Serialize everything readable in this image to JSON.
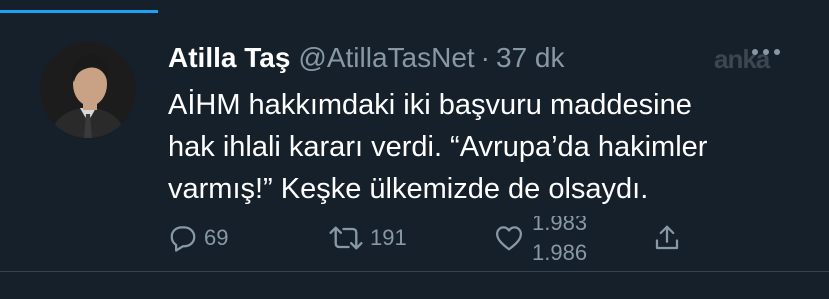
{
  "progress": {
    "fraction": 0.19,
    "color": "#1da1f2"
  },
  "tweet": {
    "author_name": "Atilla Taş",
    "handle": "@AtillaTasNet",
    "separator": "·",
    "time": "37 dk",
    "text": "AİHM hakkımdaki iki başvuru maddesine\nhak ihlali kararı verdi. “Avrupa’da hakimler\nvarmış!” Keşke ülkemizde de olsaydı."
  },
  "actions": {
    "reply_count": "69",
    "retweet_count": "191",
    "like_count_prev": "1.983",
    "like_count_next": "1.986"
  },
  "watermark": "anka",
  "icons": {
    "avatar": "avatar",
    "more": "more-icon",
    "reply": "reply-icon",
    "retweet": "retweet-icon",
    "like": "heart-icon",
    "share": "share-icon"
  },
  "colors": {
    "background": "#15202b",
    "secondary_text": "#8899a6",
    "accent": "#1da1f2"
  }
}
